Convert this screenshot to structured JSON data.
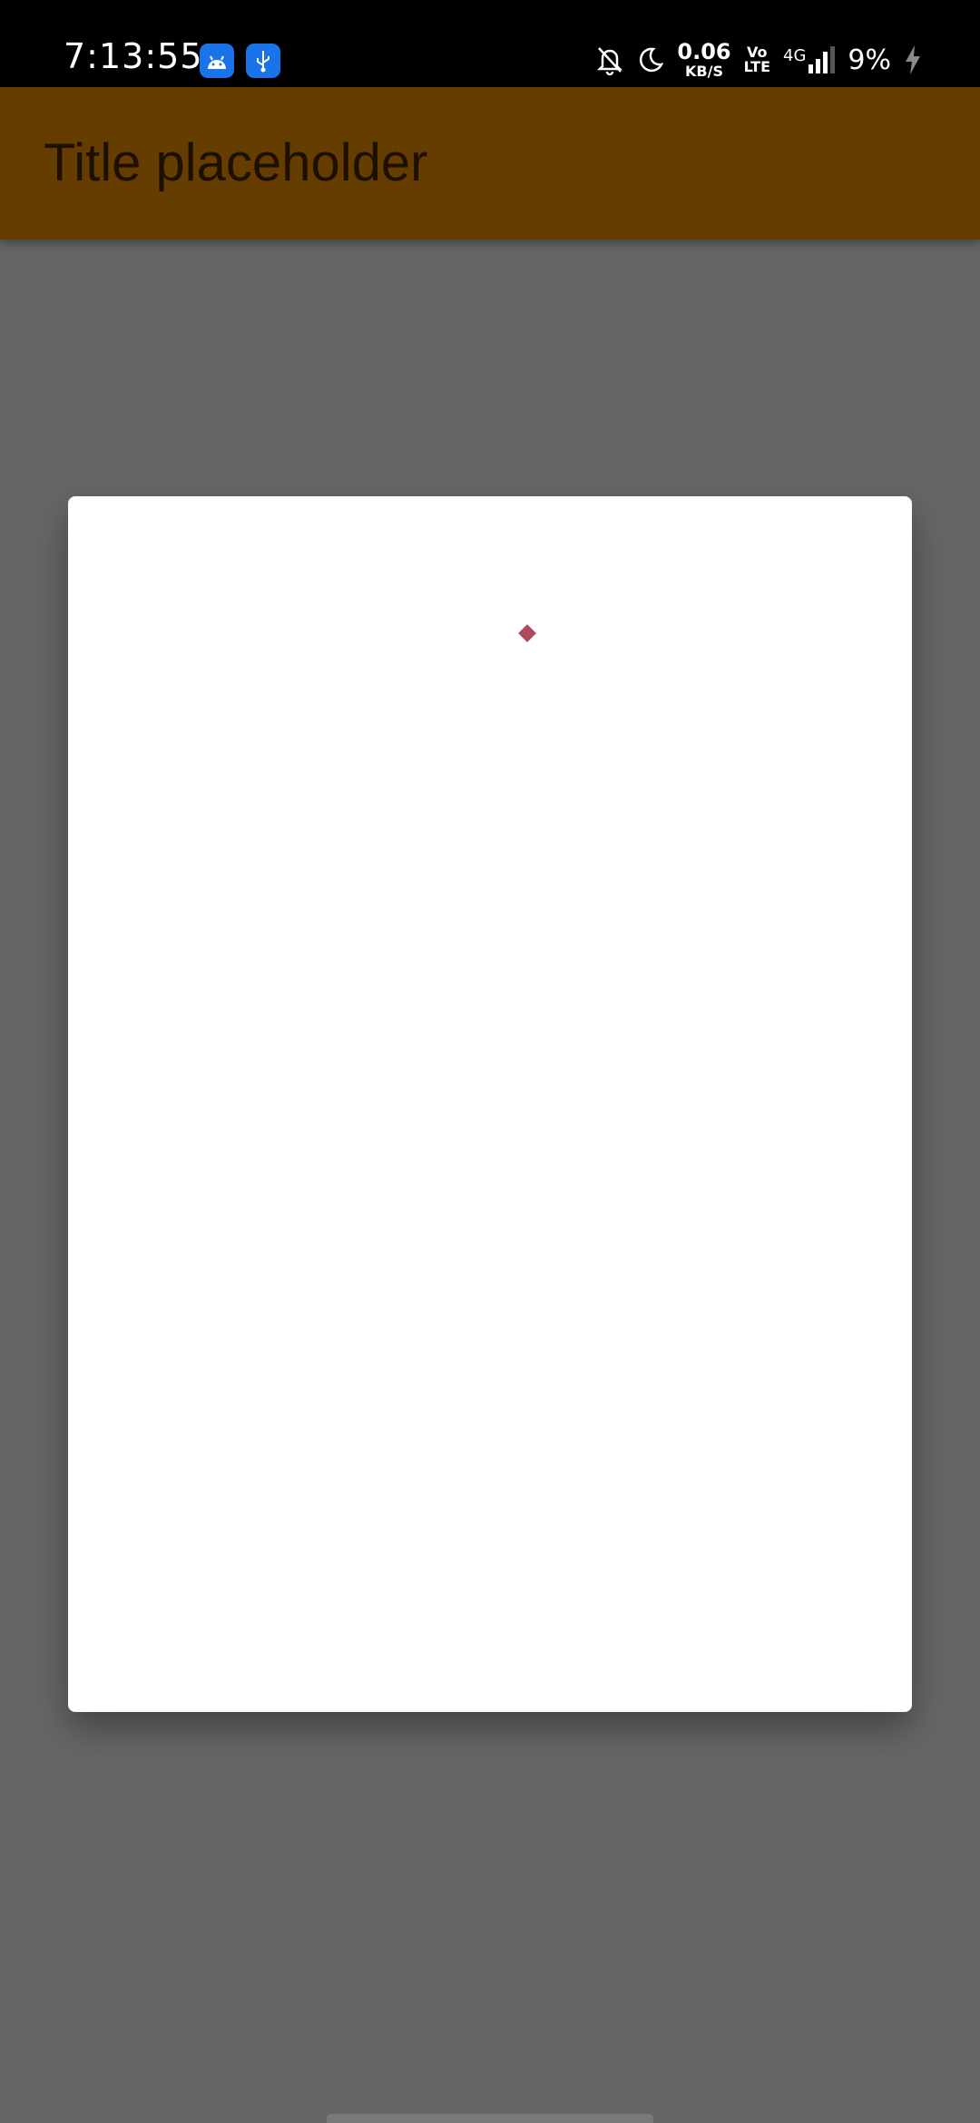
{
  "status_bar": {
    "time": "7:13:55",
    "net_speed_value": "0.06",
    "net_speed_unit": "KB/S",
    "volte_top": "Vo",
    "volte_bottom": "LTE",
    "network_type": "4G",
    "battery": "9%",
    "icons": [
      "android-icon",
      "usb-icon",
      "bell-off-icon",
      "moon-icon",
      "signal-icon",
      "charging-icon"
    ]
  },
  "app_bar": {
    "title": "Title placeholder",
    "background": "#663d00"
  },
  "dialog": {
    "state": "loading",
    "indicator_color": "#b04a5a"
  }
}
